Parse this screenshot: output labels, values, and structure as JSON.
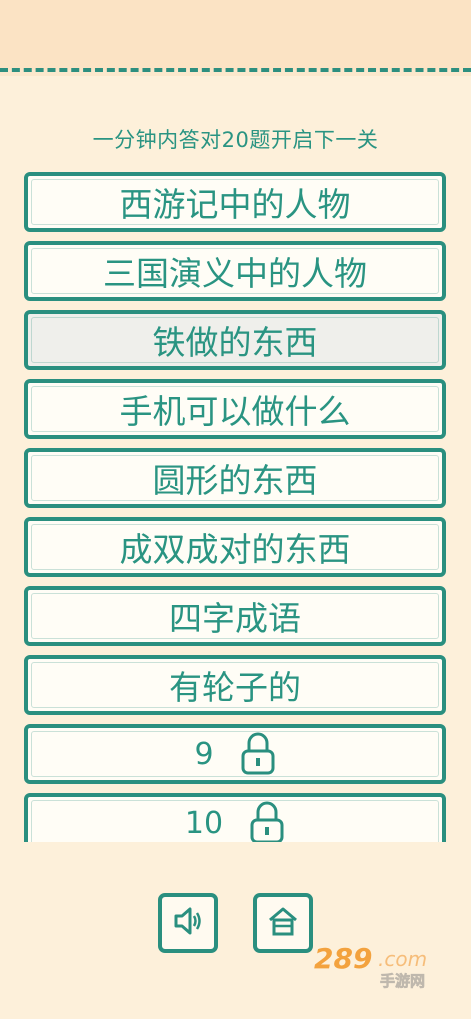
{
  "header": {
    "subtitle": "一分钟内答对20题开启下一关"
  },
  "levels": [
    {
      "label": "西游记中的人物",
      "locked": false
    },
    {
      "label": "三国演义中的人物",
      "locked": false
    },
    {
      "label": "铁做的东西",
      "locked": false,
      "selected": true
    },
    {
      "label": "手机可以做什么",
      "locked": false
    },
    {
      "label": "圆形的东西",
      "locked": false
    },
    {
      "label": "成双成对的东西",
      "locked": false
    },
    {
      "label": "四字成语",
      "locked": false
    },
    {
      "label": "有轮子的",
      "locked": false
    },
    {
      "label": "9",
      "locked": true
    },
    {
      "label": "10",
      "locked": true
    }
  ],
  "controls": {
    "sound_icon": "speaker-icon",
    "home_icon": "home-icon"
  },
  "watermark": {
    "logo": "289.com",
    "sub": "手游网"
  },
  "colors": {
    "primary": "#2a8f7f",
    "text": "#2a9482",
    "background": "#fdf0da",
    "selected": "#efefeb"
  }
}
